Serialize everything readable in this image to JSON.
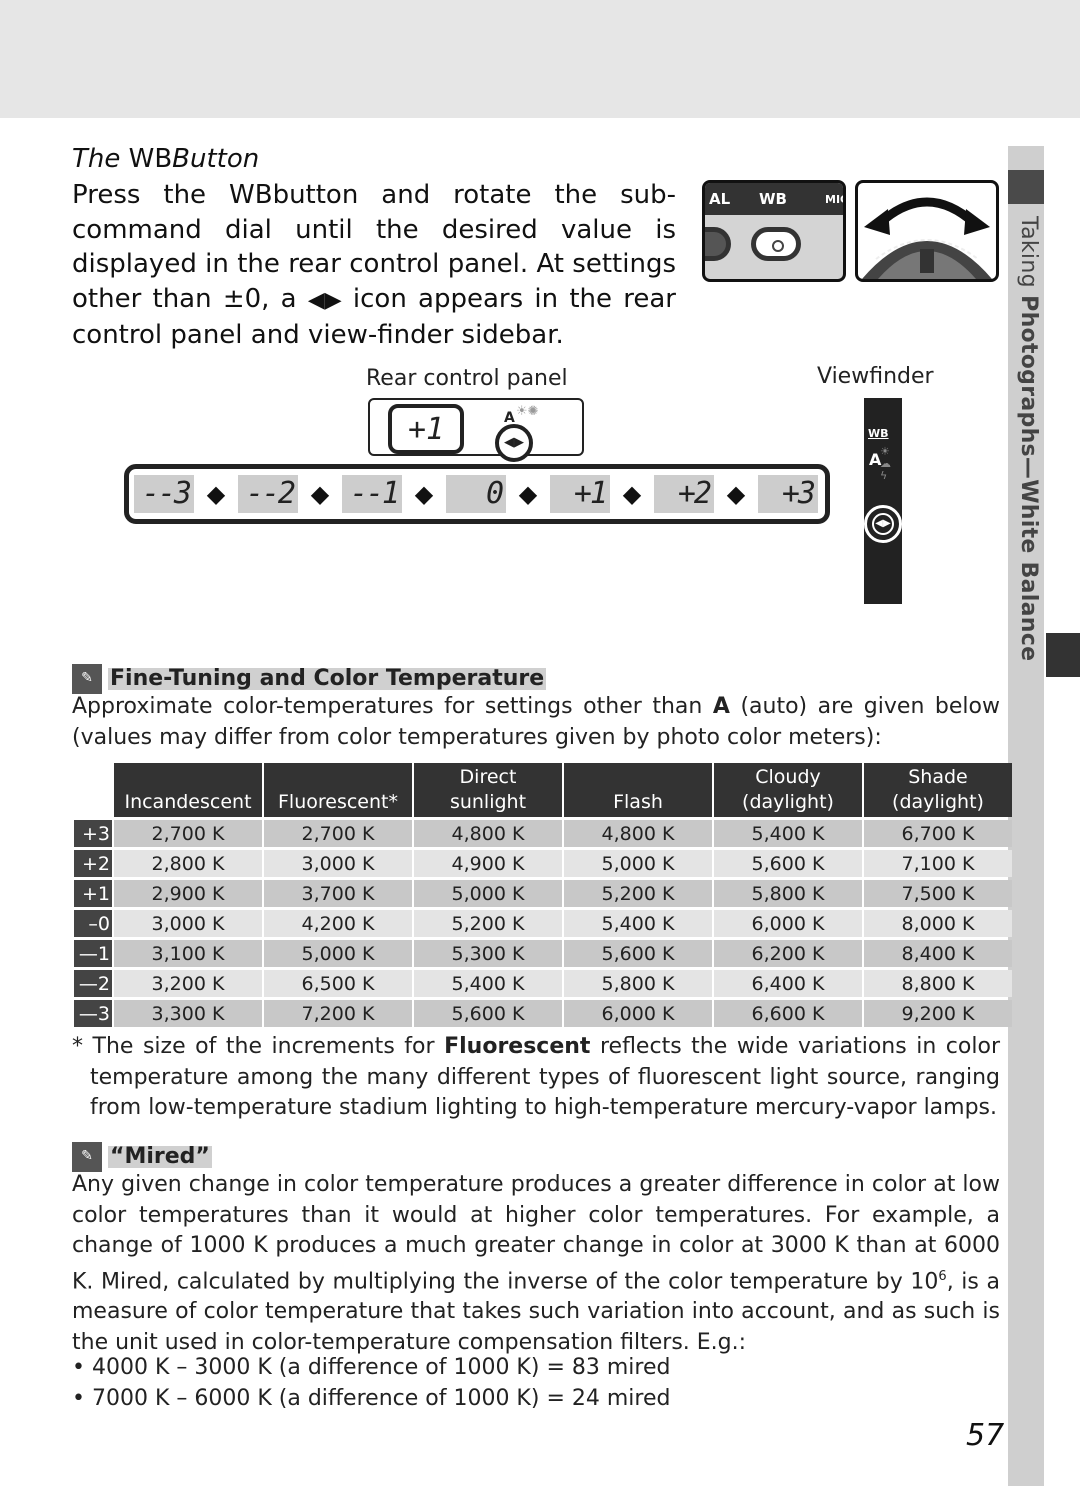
{
  "section_title_prefix": "The ",
  "section_title_button": "WB",
  "section_title_suffix": "Button",
  "intro": {
    "line1_a": "Press the ",
    "line1_wb": "WB",
    "line1_b": "button and rotate the sub-command dial until the desired value is displayed in the rear control panel.  At settings other than ±0, a ",
    "icon_glyph": "◀▶",
    "line1_c": " icon appears in the rear control panel and view-finder sidebar."
  },
  "camera_button": {
    "labels": [
      "AL",
      "WB",
      "MIC"
    ]
  },
  "diagram": {
    "rear_label": "Rear control panel",
    "viewfinder_label": "Viewfinder",
    "rear_value": "+1",
    "rear_auto": "A",
    "rear_icons": "☀✺",
    "fine_tune_glyph": "◀▶",
    "vf_wb": "WB",
    "vf_auto": "A",
    "vf_icons": "☀☁ϟ",
    "scale": [
      "--3",
      "--2",
      "--1",
      "0",
      "+1",
      "+2",
      "+3"
    ],
    "separator": "◆"
  },
  "sidebar": {
    "label_normal": "Taking ",
    "label_bold": "Photographs—White Balance"
  },
  "tip1": {
    "title": "Fine-Tuning and Color Temperature",
    "body_a": "Approximate color-temperatures for settings other than ",
    "body_bold": "A",
    "body_b": " (auto) are given below (values may differ from color temperatures given by photo color meters):"
  },
  "table": {
    "headers": [
      {
        "l1": "",
        "l2": "Incandescent"
      },
      {
        "l1": "",
        "l2": "Fluorescent*"
      },
      {
        "l1": "Direct",
        "l2": "sunlight"
      },
      {
        "l1": "",
        "l2": "Flash"
      },
      {
        "l1": "Cloudy",
        "l2": "(daylight)"
      },
      {
        "l1": "Shade",
        "l2": "(daylight)"
      }
    ],
    "rows": [
      {
        "level": "+3",
        "values": [
          "2,700 K",
          "2,700 K",
          "4,800 K",
          "4,800 K",
          "5,400 K",
          "6,700 K"
        ]
      },
      {
        "level": "+2",
        "values": [
          "2,800 K",
          "3,000 K",
          "4,900 K",
          "5,000 K",
          "5,600 K",
          "7,100 K"
        ]
      },
      {
        "level": "+1",
        "values": [
          "2,900 K",
          "3,700 K",
          "5,000 K",
          "5,200 K",
          "5,800 K",
          "7,500 K"
        ]
      },
      {
        "level": "–0",
        "values": [
          "3,000 K",
          "4,200 K",
          "5,200 K",
          "5,400 K",
          "6,000 K",
          "8,000 K"
        ]
      },
      {
        "level": "—1",
        "values": [
          "3,100 K",
          "5,000 K",
          "5,300 K",
          "5,600 K",
          "6,200 K",
          "8,400 K"
        ]
      },
      {
        "level": "—2",
        "values": [
          "3,200 K",
          "6,500 K",
          "5,400 K",
          "5,800 K",
          "6,400 K",
          "8,800 K"
        ]
      },
      {
        "level": "—3",
        "values": [
          "3,300 K",
          "7,200 K",
          "5,600 K",
          "6,000 K",
          "6,600 K",
          "9,200 K"
        ]
      }
    ]
  },
  "footnote": {
    "a": "* The size of the increments for ",
    "bold": "Fluorescent",
    "b": " reflects the wide variations in color temperature among the many different types of fluorescent light source, ranging from low-temperature stadium lighting to high-temperature mercury-vapor lamps."
  },
  "tip2": {
    "title": "“Mired”",
    "body_a": "Any given change in color temperature produces a greater difference in color at low color temperatures than it would at higher color temperatures.  For example, a change of 1000 K produces a much greater change in color at 3000 K than at 6000 K.  Mired, calculated by multiplying the inverse of the color temperature by 10",
    "body_sup": "6",
    "body_b": ", is a measure of color temperature that takes such variation into account, and as such is the unit used in color-temperature compensation filters.  E.g.:",
    "bullets": [
      "• 4000 K – 3000 K (a difference of 1000 K) = 83 mired",
      "• 7000 K – 6000 K (a difference of 1000 K) = 24 mired"
    ]
  },
  "page_number": "57"
}
